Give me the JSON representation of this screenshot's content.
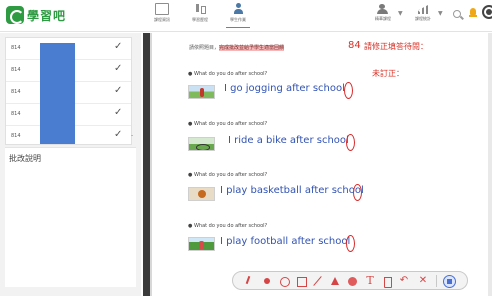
{
  "app": {
    "logo_text": "學習吧"
  },
  "toolbar": {
    "items": [
      {
        "label": "課程資訊",
        "icon": "tile-icon"
      },
      {
        "label": "學習歷程",
        "icon": "scan-icon"
      },
      {
        "label": "學生作業",
        "icon": "student-icon"
      }
    ],
    "right": [
      {
        "label": "精華課程",
        "icon": "group-icon"
      },
      {
        "label": "課程統計",
        "icon": "bars-icon"
      }
    ]
  },
  "roster": {
    "rows": [
      {
        "id": "814",
        "status": "✓"
      },
      {
        "id": "814",
        "status": "✓"
      },
      {
        "id": "814",
        "status": "✓"
      },
      {
        "id": "814",
        "status": "✓"
      },
      {
        "id": "814",
        "status": "✓"
      }
    ],
    "scroll_marker": "-"
  },
  "notes": {
    "title": "批改說明"
  },
  "header": {
    "info_prefix": "請依照題目，",
    "info_highlight": "完成批改並給予學生適當回饋",
    "score": "84",
    "review_text": "請修正填答待閱：",
    "unreviewed": "未訂正："
  },
  "questions": [
    {
      "prompt": "● What do you do after school?",
      "answer": "I go jogging after school",
      "thumb": "jogging"
    },
    {
      "prompt": "● What do you do after school?",
      "answer": "I ride a bike after school",
      "thumb": "bike"
    },
    {
      "prompt": "● What do you do after school?",
      "answer": "I play basketball after school",
      "thumb": "basketball"
    },
    {
      "prompt": "● What do you do after school?",
      "answer": "I play football after school",
      "thumb": "football"
    }
  ],
  "annotation_tools": {
    "text_tool": "T",
    "undo": "↶",
    "close": "✕"
  },
  "colors": {
    "brand": "#2e9b43",
    "answer": "#3253b3",
    "alert": "#d93025",
    "roster_mask": "#4a7ccf"
  }
}
